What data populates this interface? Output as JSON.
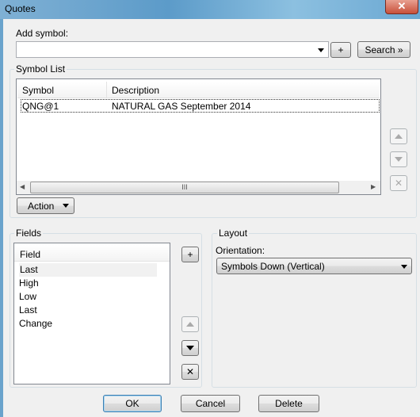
{
  "window": {
    "title": "Quotes",
    "close": "✕"
  },
  "add_symbol": {
    "label": "Add symbol:",
    "value": "",
    "plus": "+",
    "search": "Search »"
  },
  "symbol_list": {
    "label": "Symbol List",
    "columns": [
      "Symbol",
      "Description"
    ],
    "rows": [
      {
        "symbol": "QNG@1",
        "description": "NATURAL GAS September 2014"
      }
    ],
    "action": "Action"
  },
  "fields": {
    "label": "Fields",
    "header": "Field",
    "items": [
      "Last",
      "High",
      "Low",
      "Last",
      "Change"
    ],
    "plus": "+",
    "remove": "✕"
  },
  "layout": {
    "label": "Layout",
    "orientation_label": "Orientation:",
    "orientation_value": "Symbols Down (Vertical)"
  },
  "buttons": {
    "ok": "OK",
    "cancel": "Cancel",
    "delete": "Delete"
  }
}
